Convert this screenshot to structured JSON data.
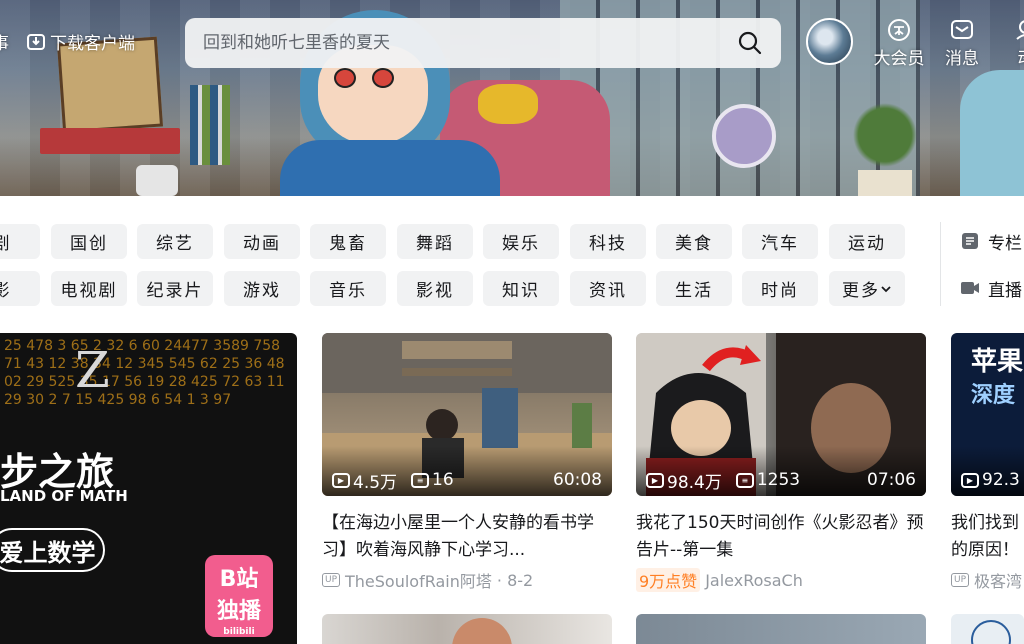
{
  "header": {
    "left_cut_text": "事",
    "download_label": "下载客户端",
    "search_placeholder": "回到和她听七里香的夏天",
    "nav": [
      {
        "label": "大会员"
      },
      {
        "label": "消息"
      },
      {
        "label": "动"
      }
    ]
  },
  "channels": {
    "row1": [
      "剧",
      "国创",
      "综艺",
      "动画",
      "鬼畜",
      "舞蹈",
      "娱乐",
      "科技",
      "美食",
      "汽车",
      "运动"
    ],
    "row2": [
      "影",
      "电视剧",
      "纪录片",
      "游戏",
      "音乐",
      "影视",
      "知识",
      "资讯",
      "生活",
      "时尚",
      "更多"
    ],
    "side": [
      {
        "label": "专栏"
      },
      {
        "label": "直播"
      }
    ]
  },
  "feature": {
    "big_text": "步之旅",
    "sub_text": "LAND OF MATH",
    "pill_text": "爱上数学",
    "badge_line1": "B站",
    "badge_line2": "独播",
    "badge_foot": "bilibili",
    "numbers_text": "25 478 3 65 2 32 6 60 24477 3589 758 71 43 12 38 34 12 345 545 62 25 36 48 02 29 525 35 17 56 19 28 425 72 63 11 29 30 2 7 15 425 98 6 54 1 3 97"
  },
  "cards": [
    {
      "views": "4.5万",
      "danmaku": "16",
      "duration": "60:08",
      "title": "【在海边小屋里一个人安静的看书学习】吹着海风静下心学习...",
      "up_badge": "UP",
      "author": "TheSoulofRain阿塔",
      "date": "· 8-2"
    },
    {
      "views": "98.4万",
      "danmaku": "1253",
      "duration": "07:06",
      "title": "我花了150天时间创作《火影忍者》预告片--第一集",
      "likes": "9万点赞",
      "author": "JalexRosaCh"
    },
    {
      "views": "92.3",
      "title_cut": "我们找到",
      "title_cut2": "的原因！",
      "up_badge": "UP",
      "author": "极客湾",
      "thumb_text1": "苹果",
      "thumb_text2": "深度"
    }
  ]
}
